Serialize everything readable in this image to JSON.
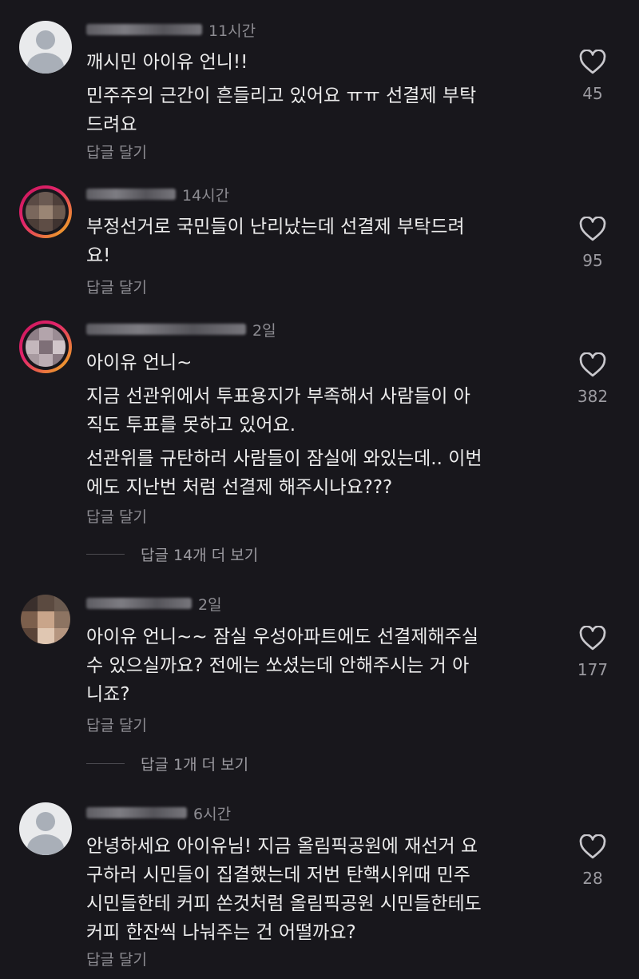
{
  "comments": [
    {
      "time": "11시간",
      "lines": [
        "깨시민 아이유 언니!!",
        "민주주의 근간이 흔들리고 있어요 ㅠㅠ 선결제 부탁\n드려요"
      ],
      "reply_label": "답글 달기",
      "likes": "45",
      "icon": "heart-icon"
    },
    {
      "time": "14시간",
      "lines": [
        "부정선거로 국민들이 난리났는데 선결제 부탁드려\n요!"
      ],
      "reply_label": "답글 달기",
      "likes": "95",
      "icon": "heart-icon"
    },
    {
      "time": "2일",
      "lines": [
        "아이유 언니~",
        "지금 선관위에서 투표용지가 부족해서 사람들이 아\n직도 투표를 못하고 있어요.",
        "선관위를 규탄하러 사람들이 잠실에 와있는데.. 이번\n에도  지난번 처럼 선결제 해주시나요???"
      ],
      "reply_label": "답글 달기",
      "likes": "382",
      "more_replies": "답글 14개 더 보기",
      "icon": "heart-icon"
    },
    {
      "time": "2일",
      "lines": [
        "아이유 언니~~ 잠실 우성아파트에도 선결제해주실\n수 있으실까요? 전에는 쏘셨는데 안해주시는 거 아\n니죠?"
      ],
      "reply_label": "답글 달기",
      "likes": "177",
      "more_replies": "답글 1개 더 보기",
      "icon": "heart-icon"
    },
    {
      "time": "6시간",
      "lines": [
        "안녕하세요 아이유님! 지금 올림픽공원에 재선거 요\n구하러 시민들이 집결했는데 저번 탄핵시위때 민주\n시민들한테 커피 쏜것처럼 올림픽공원 시민들한테도\n커피 한잔씩 나눠주는 건 어떨까요?"
      ],
      "reply_label": "답글 달기",
      "likes": "28",
      "icon": "heart-icon"
    }
  ],
  "colors": {
    "background": "#18171c",
    "text": "#ececec",
    "muted": "#8d8c92",
    "story_ring": "#e3256b"
  }
}
